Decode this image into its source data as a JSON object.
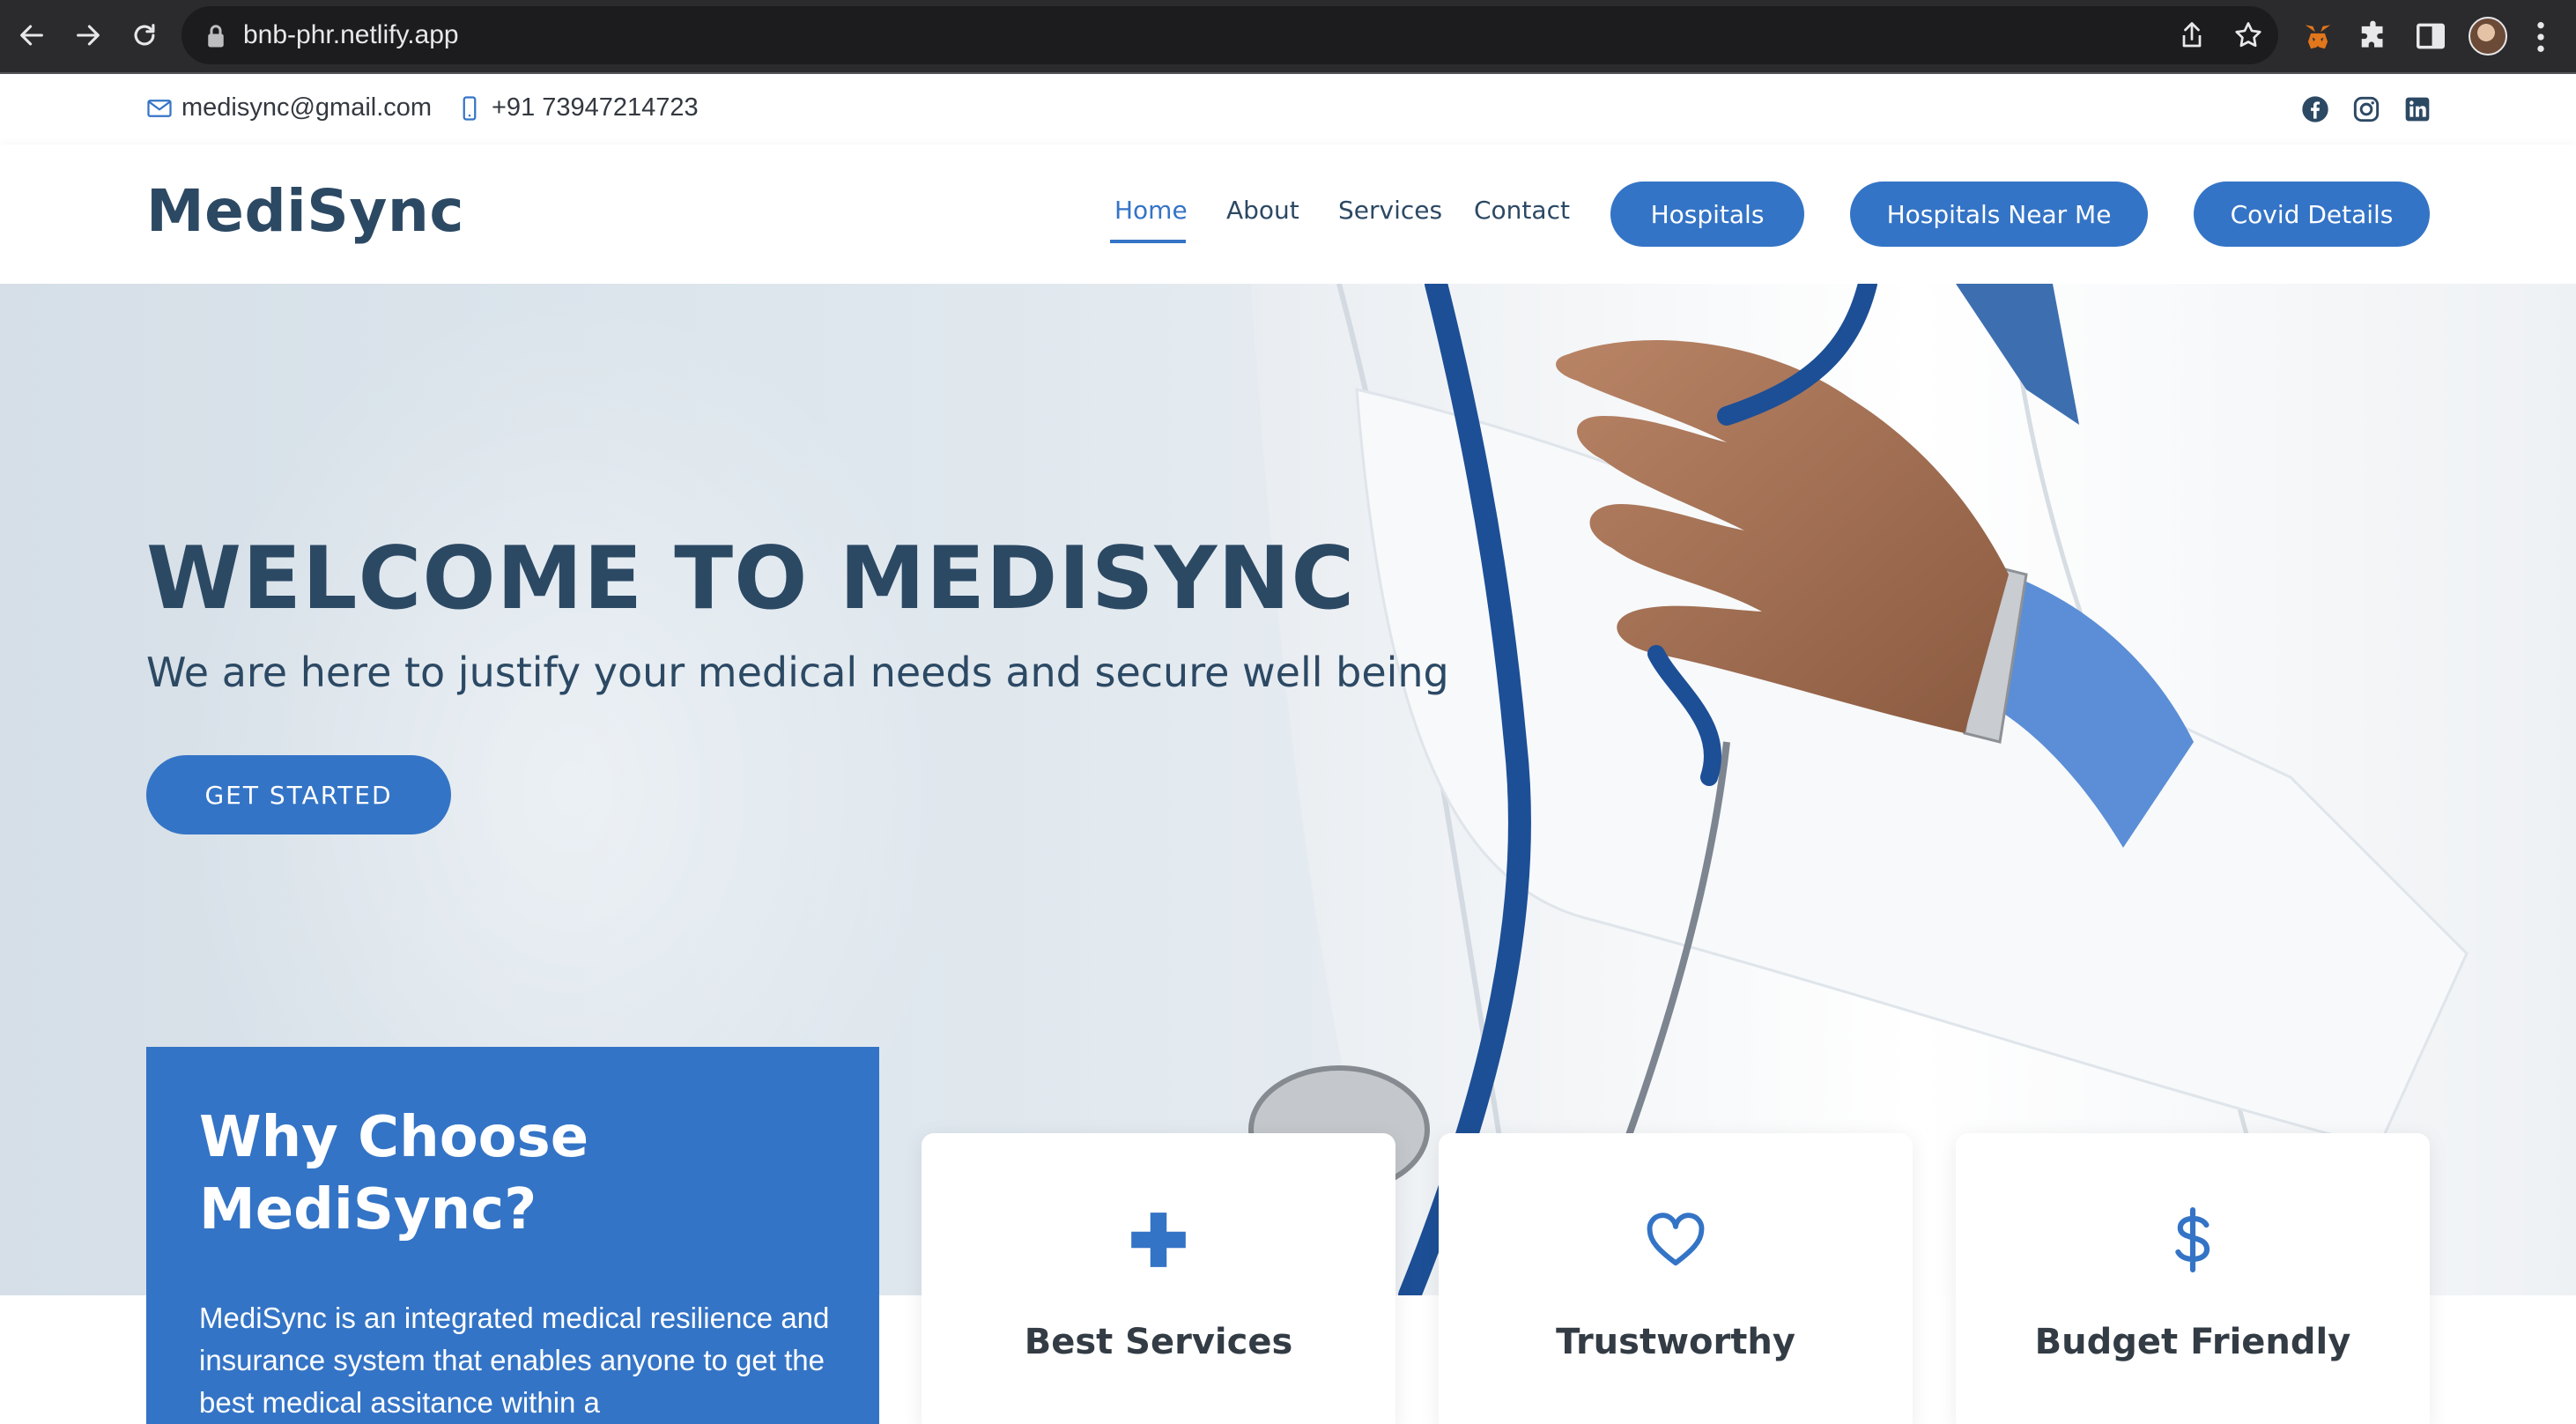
{
  "browser": {
    "url": "bnb-phr.netlify.app",
    "icons": [
      "back-arrow-icon",
      "forward-arrow-icon",
      "reload-icon",
      "lock-icon",
      "share-icon",
      "star-icon",
      "metamask-icon",
      "puzzle-icon",
      "sidebar-icon",
      "profile-avatar",
      "menu-dots-icon"
    ]
  },
  "topbar": {
    "email": "medisync@gmail.com",
    "phone": "+91 73947214723",
    "social": [
      "facebook-icon",
      "instagram-icon",
      "linkedin-icon"
    ]
  },
  "header": {
    "logo": "MediSync",
    "nav": {
      "home": "Home",
      "about": "About",
      "services": "Services",
      "contact": "Contact"
    },
    "buttons": {
      "hospitals": "Hospitals",
      "hospitals_near_me": "Hospitals Near Me",
      "covid_details": "Covid Details"
    }
  },
  "hero": {
    "title": "WELCOME TO MEDISYNC",
    "subtitle": "We are here to justify your medical needs and secure well being",
    "cta": "GET STARTED"
  },
  "why": {
    "title": "Why Choose MediSync?",
    "text": "MediSync is an integrated medical resilience and insurance system that enables anyone to get the best medical assitance within a"
  },
  "features": [
    {
      "label": "Best Services",
      "icon": "plus-icon"
    },
    {
      "label": "Trustworthy",
      "icon": "heart-icon"
    },
    {
      "label": "Budget Friendly",
      "icon": "dollar-icon"
    }
  ],
  "colors": {
    "primary": "#3474c6",
    "heading": "#2c4964",
    "chrome": "#2b2b2d"
  }
}
